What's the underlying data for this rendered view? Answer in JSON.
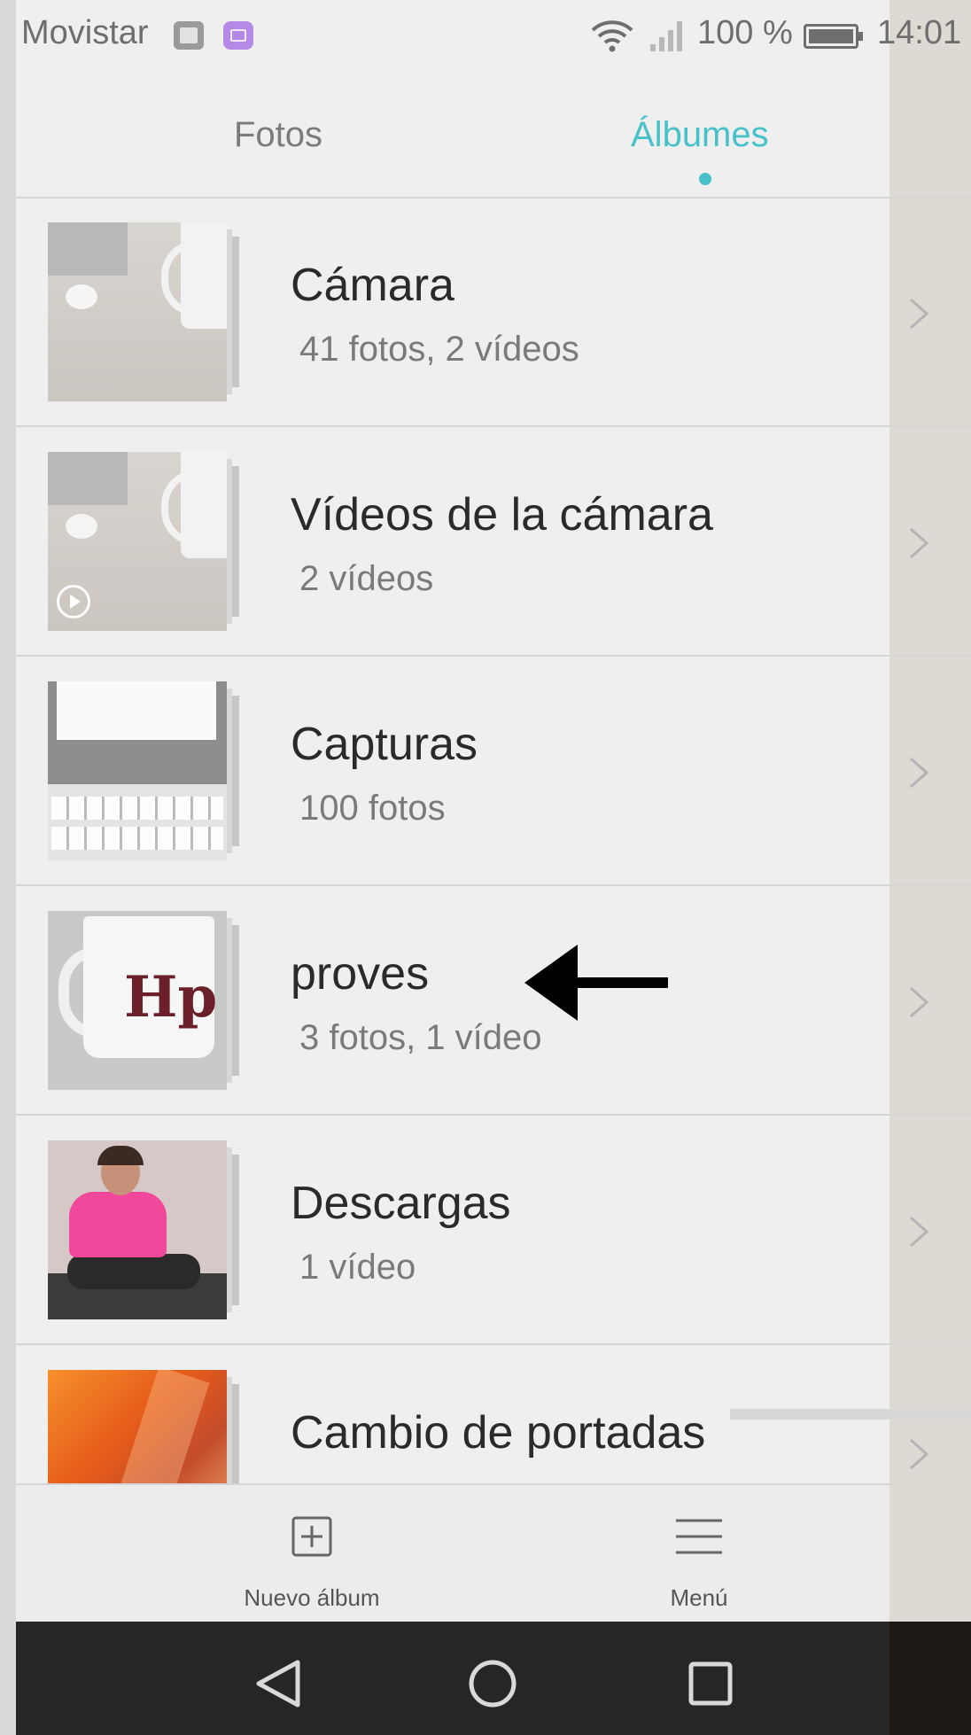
{
  "status_bar": {
    "carrier": "Movistar",
    "battery_percent": "100 %",
    "time": "14:01",
    "icons": [
      "gallery-notification-icon",
      "keyboard-notification-icon",
      "wifi-icon",
      "signal-icon",
      "battery-icon"
    ]
  },
  "tabs": [
    {
      "label": "Fotos",
      "active": false
    },
    {
      "label": "Álbumes",
      "active": true
    }
  ],
  "albums": [
    {
      "title": "Cámara",
      "subtitle": "41 fotos,  2 vídeos"
    },
    {
      "title": "Vídeos de la cámara",
      "subtitle": "2 vídeos"
    },
    {
      "title": "Capturas",
      "subtitle": "100 fotos"
    },
    {
      "title": "proves",
      "subtitle": "3 fotos,  1 vídeo"
    },
    {
      "title": "Descargas",
      "subtitle": "1 vídeo"
    },
    {
      "title": "Cambio de portadas",
      "subtitle": ""
    }
  ],
  "bottom_bar": {
    "new_album_label": "Nuevo álbum",
    "menu_label": "Menú"
  },
  "colors": {
    "accent": "#47c2c9",
    "background": "#efefef",
    "navbar": "#262626"
  }
}
